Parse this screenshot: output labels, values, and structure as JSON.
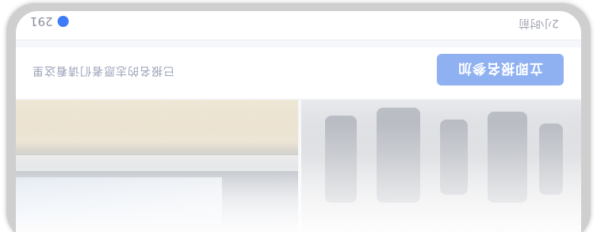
{
  "card": {
    "meta": {
      "count": "291",
      "right_text": "2小时前"
    },
    "action": {
      "caption": "已报名的志愿者们请看这里",
      "button_label": "立即报名参加"
    }
  },
  "colors": {
    "accent": "#3e7bf7",
    "button_bg": "#8fb1f2"
  }
}
